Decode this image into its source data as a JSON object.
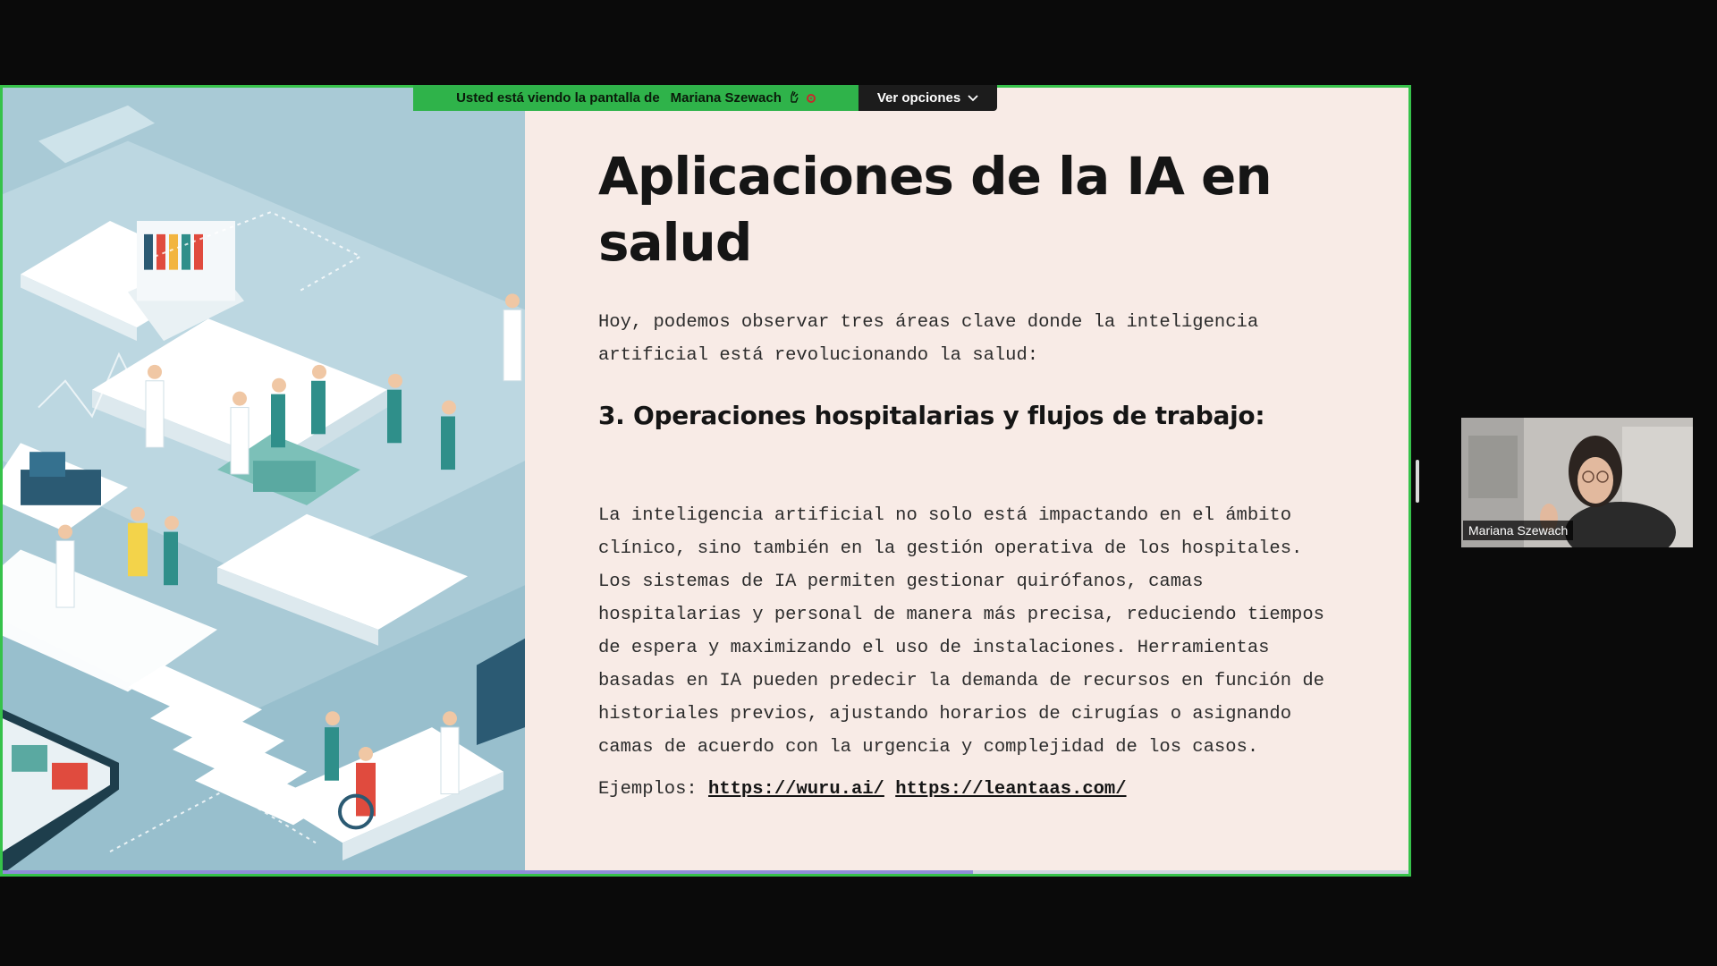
{
  "share_banner": {
    "text": "Usted está viendo la pantalla de",
    "presenter": "Mariana Szewach",
    "options_label": "Ver opciones"
  },
  "slide": {
    "title": "Aplicaciones de la IA en salud",
    "intro": "Hoy, podemos observar tres áreas clave donde la inteligencia artificial está revolucionando la salud:",
    "section_heading": "3. Operaciones hospitalarias y flujos de trabajo:",
    "body": "La inteligencia artificial no solo está impactando en el ámbito clínico, sino también en la gestión operativa de los hospitales. Los sistemas de IA permiten gestionar quirófanos, camas hospitalarias y personal de manera más precisa, reduciendo tiempos de espera y maximizando el uso de instalaciones. Herramientas basadas en IA pueden predecir la demanda de recursos en función de historiales previos, ajustando horarios de cirugías o asignando camas de acuerdo con la urgencia y complejidad de los casos.",
    "examples_label": "Ejemplos:",
    "links": [
      "https://wuru.ai/",
      "https://leantaas.com/"
    ],
    "progress_fraction": 0.69
  },
  "participant": {
    "name": "Mariana Szewach"
  },
  "colors": {
    "share_border": "#36c24a",
    "banner_green": "#2fb34a",
    "slide_background": "#f8ebe6",
    "title_text": "#151515",
    "illustration_base": "#a9cad6"
  },
  "icons": [
    "hand-raise-icon",
    "record-icon",
    "chevron-down-icon"
  ]
}
